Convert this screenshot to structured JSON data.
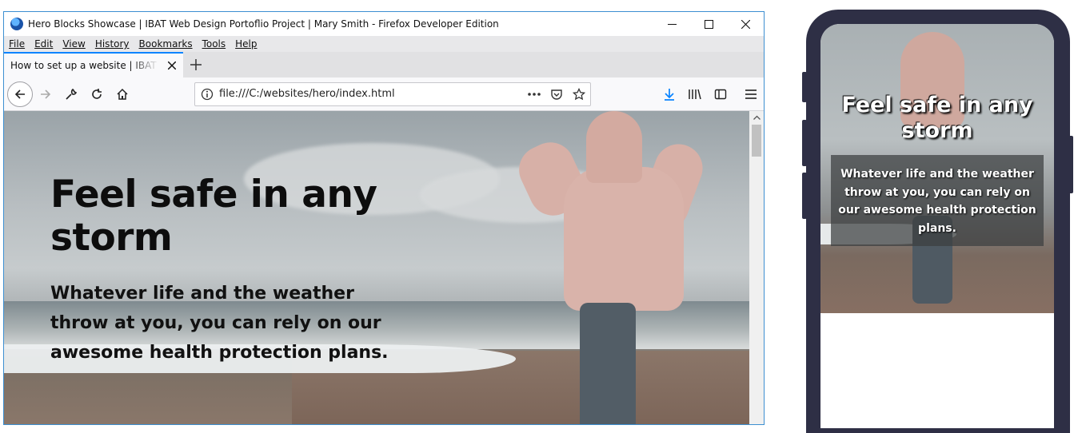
{
  "browser": {
    "title": "Hero Blocks Showcase | IBAT Web Design Portoflio Project | Mary Smith - Firefox Developer Edition",
    "window_controls": {
      "minimize_icon": "minimize-icon",
      "maximize_icon": "maximize-icon",
      "close_icon": "close-icon"
    },
    "menu": [
      "File",
      "Edit",
      "View",
      "History",
      "Bookmarks",
      "Tools",
      "Help"
    ],
    "tab": {
      "label": "How to set up a website | IBAT Portfolio"
    },
    "url": "file:///C:/websites/hero/index.html",
    "accent_color": "#0a84ff"
  },
  "page": {
    "hero_title": "Feel safe in any storm",
    "hero_subtitle": "Whatever life and the weather throw at you, you can rely on our awesome health protection plans."
  },
  "phone": {
    "hero_title": "Feel safe in any storm",
    "hero_subtitle": "Whatever life and the weather throw at you, you can rely on our awesome health protection plans.",
    "frame_color": "#2e2f45"
  }
}
